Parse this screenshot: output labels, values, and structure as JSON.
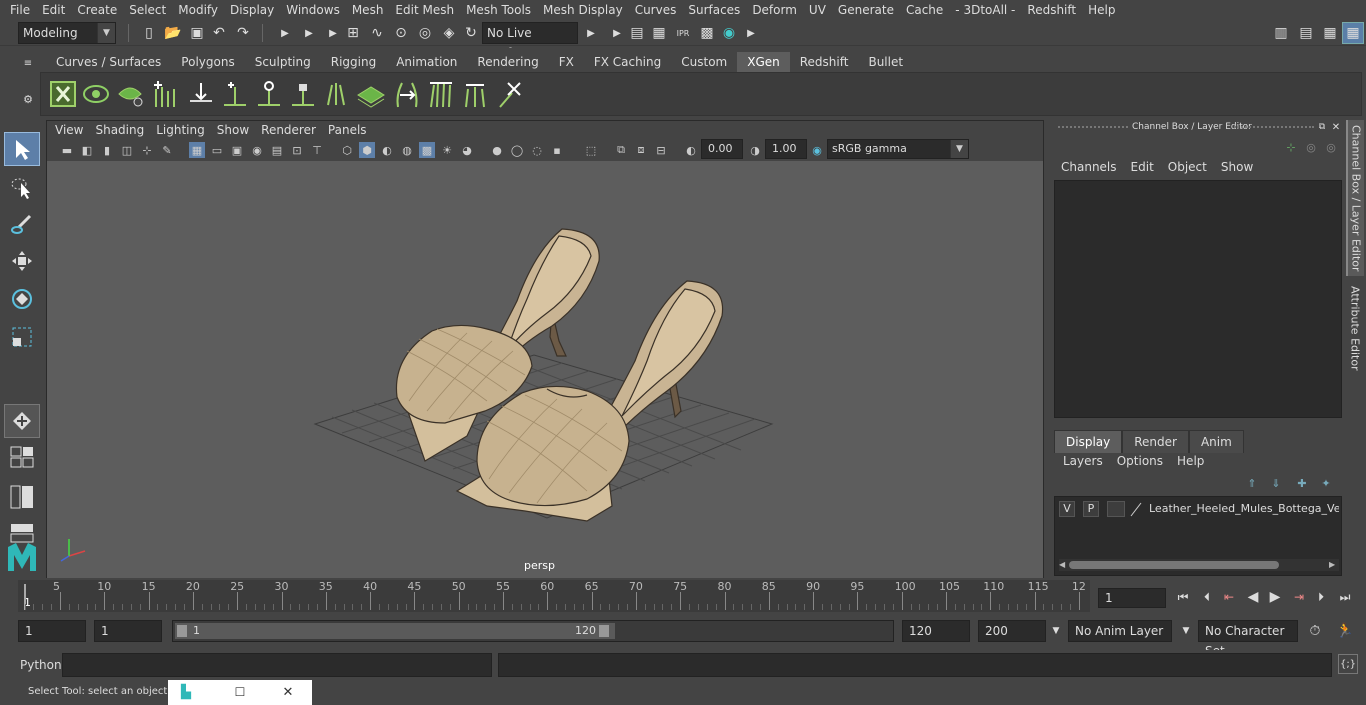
{
  "menubar": {
    "items": [
      "File",
      "Edit",
      "Create",
      "Select",
      "Modify",
      "Display",
      "Windows",
      "Mesh",
      "Edit Mesh",
      "Mesh Tools",
      "Mesh Display",
      "Curves",
      "Surfaces",
      "Deform",
      "UV",
      "Generate",
      "Cache",
      "- 3DtoAll -",
      "Redshift",
      "Help"
    ]
  },
  "status": {
    "workspace": "Modeling",
    "live_surface": "No Live Surface"
  },
  "shelf": {
    "tabs": [
      "Curves / Surfaces",
      "Polygons",
      "Sculpting",
      "Rigging",
      "Animation",
      "Rendering",
      "FX",
      "FX Caching",
      "Custom",
      "XGen",
      "Redshift",
      "Bullet"
    ],
    "active_tab": "XGen"
  },
  "viewport": {
    "menu": [
      "View",
      "Shading",
      "Lighting",
      "Show",
      "Renderer",
      "Panels"
    ],
    "exposure": "0.00",
    "gamma": "1.00",
    "color_space": "sRGB gamma",
    "camera": "persp"
  },
  "channel_box": {
    "title": "Channel Box / Layer Editor",
    "menu": [
      "Channels",
      "Edit",
      "Object",
      "Show"
    ],
    "layer_tabs": [
      "Display",
      "Render",
      "Anim"
    ],
    "active_layer_tab": "Display",
    "layer_menu": [
      "Layers",
      "Options",
      "Help"
    ],
    "layer_row": {
      "v": "V",
      "p": "P",
      "name": "Leather_Heeled_Mules_Bottega_Vene"
    }
  },
  "side_tabs": [
    "Channel Box / Layer Editor",
    "Attribute Editor"
  ],
  "timeline": {
    "ticks": [
      "5",
      "10",
      "15",
      "20",
      "25",
      "30",
      "35",
      "40",
      "45",
      "50",
      "55",
      "60",
      "65",
      "70",
      "75",
      "80",
      "85",
      "90",
      "95",
      "100",
      "105",
      "110",
      "115",
      "12"
    ],
    "start_marker": "1",
    "current_frame": "1"
  },
  "range": {
    "start": "1",
    "playback_start": "1",
    "slider_start": "1",
    "slider_end": "120",
    "playback_end": "120",
    "end": "200",
    "anim_layer": "No Anim Layer",
    "character_set": "No Character Set"
  },
  "command": {
    "label": "Python"
  },
  "help": {
    "text": "Select Tool: select an object"
  }
}
